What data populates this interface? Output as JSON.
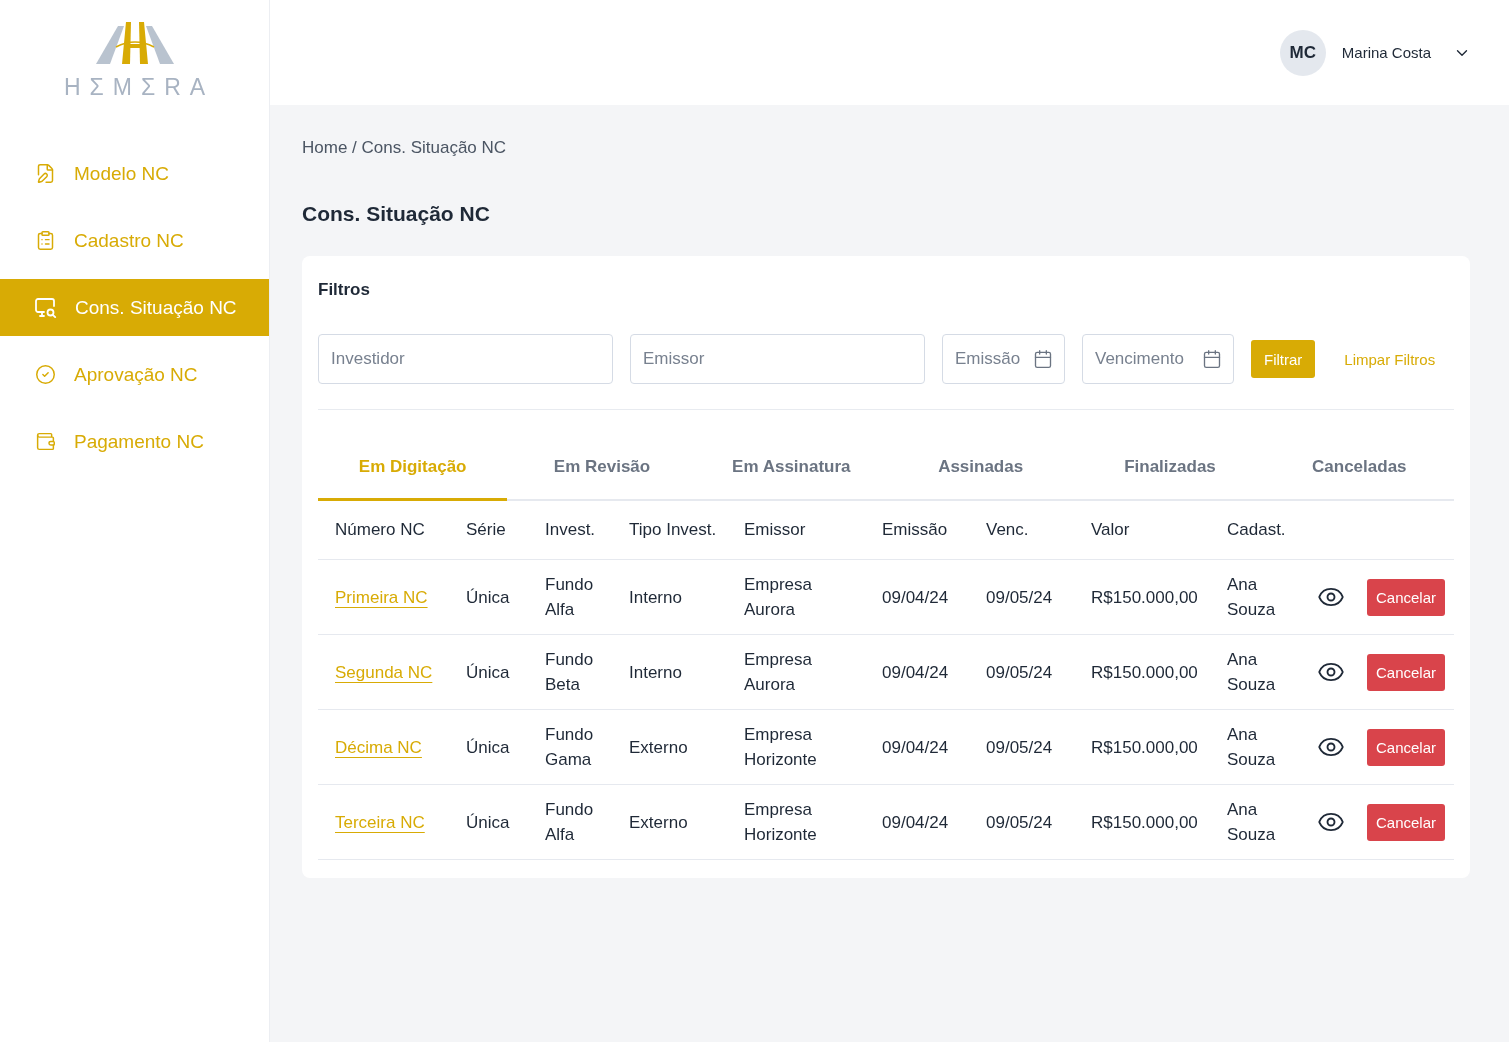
{
  "sidebar": {
    "logo": {
      "wordmark": "HΣMΣRA"
    },
    "items": [
      {
        "label": "Modelo NC",
        "selected": false
      },
      {
        "label": "Cadastro NC",
        "selected": false
      },
      {
        "label": "Cons. Situação NC",
        "selected": true
      },
      {
        "label": "Aprovação NC",
        "selected": false
      },
      {
        "label": "Pagamento NC",
        "selected": false
      }
    ]
  },
  "header": {
    "user": {
      "initials": "MC",
      "name": "Marina Costa"
    }
  },
  "breadcrumb": "Home / Cons. Situação NC",
  "page_title": "Cons. Situação NC",
  "filters": {
    "title": "Filtros",
    "fields": [
      {
        "kind": "text",
        "placeholder": "Investidor"
      },
      {
        "kind": "text",
        "placeholder": "Emissor"
      },
      {
        "kind": "date",
        "placeholder": "Emissão"
      },
      {
        "kind": "date",
        "placeholder": "Vencimento"
      }
    ],
    "apply_button": "Filtrar",
    "clear_link": "Limpar Filtros"
  },
  "tabs": [
    {
      "label": "Em Digitação",
      "selected": true
    },
    {
      "label": "Em Revisão",
      "selected": false
    },
    {
      "label": "Em Assinatura",
      "selected": false
    },
    {
      "label": "Assinadas",
      "selected": false
    },
    {
      "label": "Finalizadas",
      "selected": false
    },
    {
      "label": "Canceladas",
      "selected": false
    }
  ],
  "table": {
    "columns": [
      "Número NC",
      "Série",
      "Invest.",
      "Tipo Invest.",
      "Emissor",
      "Emissão",
      "Venc.",
      "Valor",
      "Cadast."
    ],
    "rows": [
      {
        "cells": [
          "Primeira NC",
          "Única",
          "Fundo Alfa",
          "Interno",
          "Empresa Aurora",
          "09/04/24",
          "09/05/24",
          "R$150.000,00",
          "Ana Souza"
        ],
        "action": "Cancelar"
      },
      {
        "cells": [
          "Segunda NC",
          "Única",
          "Fundo Beta",
          "Interno",
          "Empresa Aurora",
          "09/04/24",
          "09/05/24",
          "R$150.000,00",
          "Ana Souza"
        ],
        "action": "Cancelar"
      },
      {
        "cells": [
          "Décima NC",
          "Única",
          "Fundo Gama",
          "Externo",
          "Empresa Horizonte",
          "09/04/24",
          "09/05/24",
          "R$150.000,00",
          "Ana Souza"
        ],
        "action": "Cancelar"
      },
      {
        "cells": [
          "Terceira NC",
          "Única",
          "Fundo Alfa",
          "Externo",
          "Empresa Horizonte",
          "09/04/24",
          "09/05/24",
          "R$150.000,00",
          "Ana Souza"
        ],
        "action": "Cancelar"
      }
    ]
  }
}
